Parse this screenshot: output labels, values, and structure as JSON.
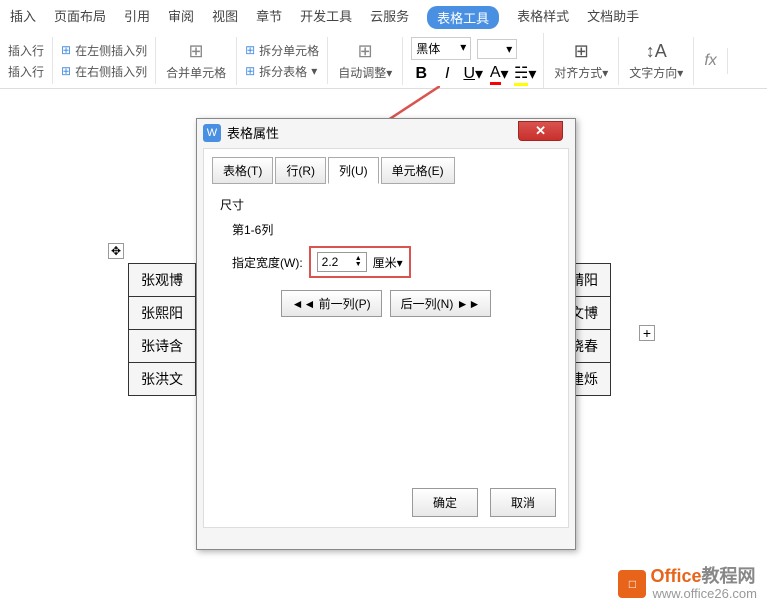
{
  "tabs": [
    "插入",
    "页面布局",
    "引用",
    "审阅",
    "视图",
    "章节",
    "开发工具",
    "云服务",
    "表格工具",
    "表格样式",
    "文档助手"
  ],
  "active_tab": "表格工具",
  "ribbon": {
    "insert_row": "插入行",
    "insert_row2": "插入行",
    "insert_left": "在左侧插入列",
    "insert_right": "在右侧插入列",
    "merge": "合并单元格",
    "split_cell": "拆分单元格",
    "split_table": "拆分表格",
    "auto_adjust": "自动调整",
    "font": "黑体",
    "align": "对齐方式",
    "text_dir": "文字方向"
  },
  "table_left": [
    "张观博",
    "张熙阳",
    "张诗含",
    "张洪文"
  ],
  "table_right": [
    "靖阳",
    "文博",
    "晓春",
    "建烁"
  ],
  "dialog": {
    "title": "表格属性",
    "tabs": {
      "table": "表格(T)",
      "row": "行(R)",
      "col": "列(U)",
      "cell": "单元格(E)"
    },
    "size_label": "尺寸",
    "col_range": "第1-6列",
    "width_label": "指定宽度(W):",
    "width_value": "2.2",
    "unit": "厘米",
    "prev": "◄◄ 前一列(P)",
    "next": "后一列(N) ►►",
    "ok": "确定",
    "cancel": "取消"
  },
  "watermark": {
    "brand": "Office",
    "brand2": "教程网",
    "url": "www.office26.com"
  }
}
